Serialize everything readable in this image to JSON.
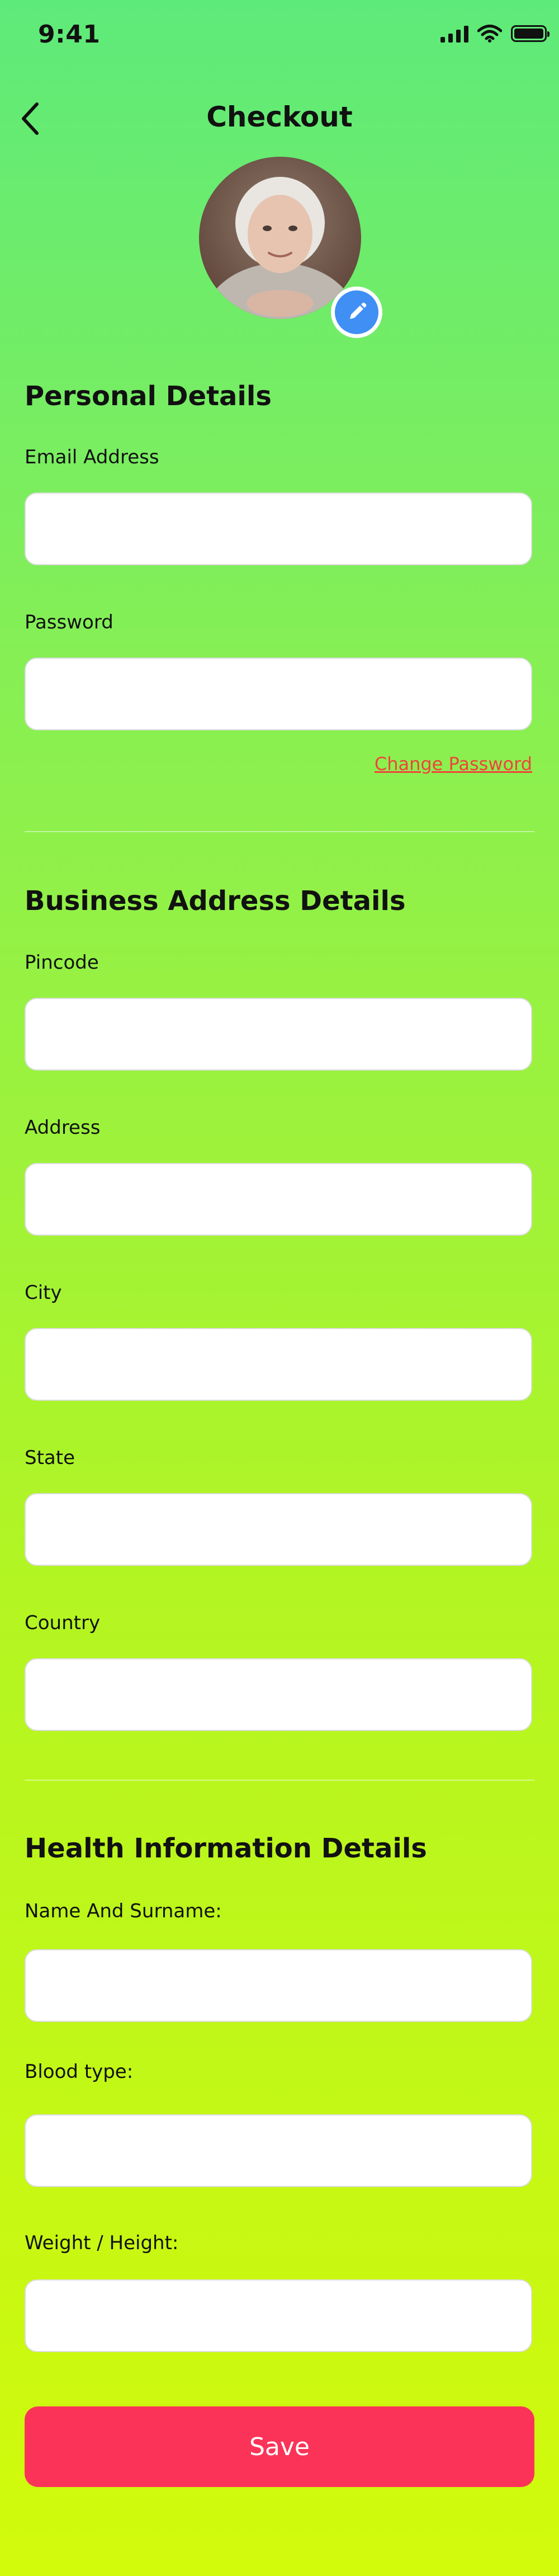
{
  "status_bar": {
    "time": "9:41"
  },
  "header": {
    "title": "Checkout"
  },
  "personal": {
    "title": "Personal Details",
    "email_label": "Email Address",
    "email_value": "",
    "password_label": "Password",
    "password_value": "",
    "change_password": "Change Password"
  },
  "business": {
    "title": "Business Address Details",
    "pincode_label": "Pincode",
    "address_label": "Address",
    "city_label": "City",
    "state_label": "State",
    "country_label": "Country"
  },
  "health": {
    "title": "Health Information Details",
    "name_label": "Name And Surname:",
    "blood_label": "Blood type:",
    "weight_label": "Weight / Height:"
  },
  "actions": {
    "save_label": "Save"
  },
  "colors": {
    "background_top": "#5EEA7A",
    "background_bottom": "#D2FA0B",
    "primary_button": "#FB3358",
    "link": "#F0443C",
    "edit_badge": "#3F8FF5"
  }
}
